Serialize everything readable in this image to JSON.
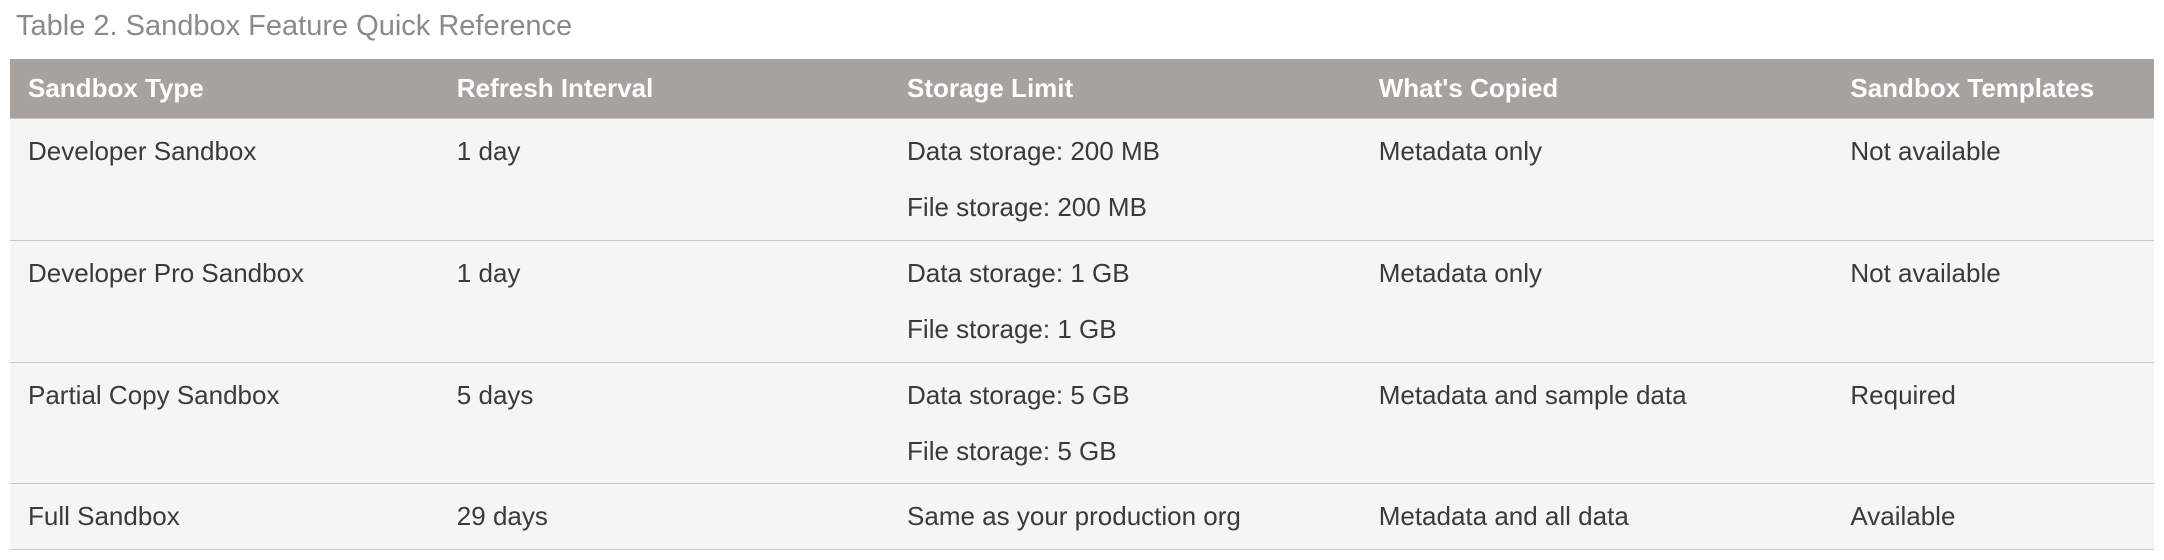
{
  "caption": "Table 2. Sandbox Feature Quick Reference",
  "headers": {
    "col0": "Sandbox Type",
    "col1": "Refresh Interval",
    "col2": "Storage Limit",
    "col3": "What's Copied",
    "col4": "Sandbox Templates"
  },
  "rows": [
    {
      "type": "Developer Sandbox",
      "refresh": "1 day",
      "storage_line1": "Data storage: 200 MB",
      "storage_line2": "File storage: 200 MB",
      "copied": "Metadata only",
      "templates": "Not available"
    },
    {
      "type": "Developer Pro Sandbox",
      "refresh": "1 day",
      "storage_line1": "Data storage: 1 GB",
      "storage_line2": "File storage: 1 GB",
      "copied": "Metadata only",
      "templates": "Not available"
    },
    {
      "type": "Partial Copy Sandbox",
      "refresh": "5 days",
      "storage_line1": "Data storage: 5 GB",
      "storage_line2": "File storage: 5 GB",
      "copied": "Metadata and sample data",
      "templates": "Required"
    },
    {
      "type": "Full Sandbox",
      "refresh": "29 days",
      "storage_line1": "Same as your production org",
      "storage_line2": "",
      "copied": "Metadata and all data",
      "templates": "Available"
    }
  ],
  "chart_data": {
    "type": "table",
    "title": "Table 2. Sandbox Feature Quick Reference",
    "columns": [
      "Sandbox Type",
      "Refresh Interval",
      "Storage Limit",
      "What's Copied",
      "Sandbox Templates"
    ],
    "data": [
      [
        "Developer Sandbox",
        "1 day",
        "Data storage: 200 MB; File storage: 200 MB",
        "Metadata only",
        "Not available"
      ],
      [
        "Developer Pro Sandbox",
        "1 day",
        "Data storage: 1 GB; File storage: 1 GB",
        "Metadata only",
        "Not available"
      ],
      [
        "Partial Copy Sandbox",
        "5 days",
        "Data storage: 5 GB; File storage: 5 GB",
        "Metadata and sample data",
        "Required"
      ],
      [
        "Full Sandbox",
        "29 days",
        "Same as your production org",
        "Metadata and all data",
        "Available"
      ]
    ]
  }
}
